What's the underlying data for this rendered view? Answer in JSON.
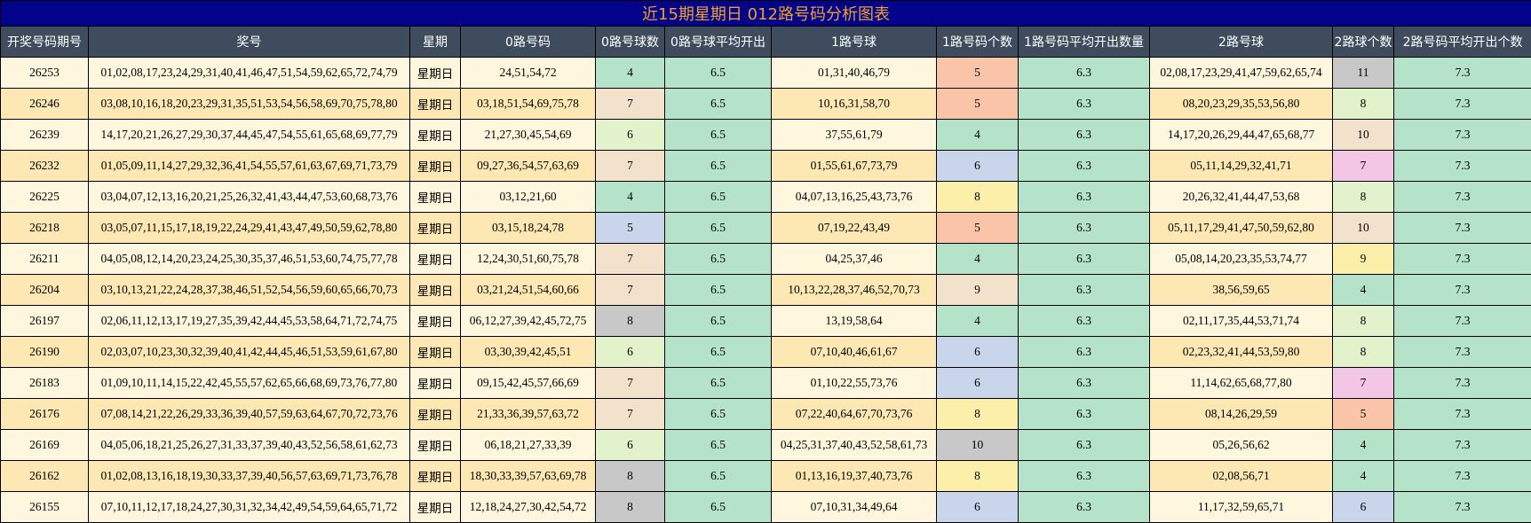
{
  "title": "近15期星期日 012路号码分析图表",
  "headers": [
    "开奖号码期号",
    "奖号",
    "星期",
    "0路号码",
    "0路号球数",
    "0路号球平均开出",
    "1路号球",
    "1路号码个数",
    "1路号码平均开出数量",
    "2路号球",
    "2路球个数",
    "2路号码平均开出个数"
  ],
  "colors": {
    "title_bg": "#02028a",
    "title_text": "#f0a030",
    "header_bg": "#3f4c5e",
    "row_light": "#fff7dd",
    "row_dark": "#fde8b3",
    "avg_green": "#b4e3c9"
  },
  "count_colors": {
    "4": "#b4e3c9",
    "5": "#f9c4a8",
    "6": "#e2f3cc",
    "7": "#f3e2cb",
    "8": "#c8c8c8",
    "9": "#f3e2cb",
    "10": "#c8c8c8",
    "11": "#c8c8c8"
  },
  "rows": [
    {
      "period": "26253",
      "numbers": "01,02,08,17,23,24,29,31,40,41,46,47,51,54,59,62,65,72,74,79",
      "weekday": "星期日",
      "r0": "24,51,54,72",
      "r0_count": "4",
      "r0_count_color": "#b4e3c9",
      "r0_avg": "6.5",
      "r1": "01,31,40,46,79",
      "r1_count": "5",
      "r1_count_color": "#f9c4a8",
      "r1_avg": "6.3",
      "r2": "02,08,17,23,29,41,47,59,62,65,74",
      "r2_count": "11",
      "r2_count_color": "#c8c8c8",
      "r2_avg": "7.3"
    },
    {
      "period": "26246",
      "numbers": "03,08,10,16,18,20,23,29,31,35,51,53,54,56,58,69,70,75,78,80",
      "weekday": "星期日",
      "r0": "03,18,51,54,69,75,78",
      "r0_count": "7",
      "r0_count_color": "#f3e2cb",
      "r0_avg": "6.5",
      "r1": "10,16,31,58,70",
      "r1_count": "5",
      "r1_count_color": "#f9c4a8",
      "r1_avg": "6.3",
      "r2": "08,20,23,29,35,53,56,80",
      "r2_count": "8",
      "r2_count_color": "#e2f3cc",
      "r2_avg": "7.3"
    },
    {
      "period": "26239",
      "numbers": "14,17,20,21,26,27,29,30,37,44,45,47,54,55,61,65,68,69,77,79",
      "weekday": "星期日",
      "r0": "21,27,30,45,54,69",
      "r0_count": "6",
      "r0_count_color": "#e2f3cc",
      "r0_avg": "6.5",
      "r1": "37,55,61,79",
      "r1_count": "4",
      "r1_count_color": "#b4e3c9",
      "r1_avg": "6.3",
      "r2": "14,17,20,26,29,44,47,65,68,77",
      "r2_count": "10",
      "r2_count_color": "#f3e2cb",
      "r2_avg": "7.3"
    },
    {
      "period": "26232",
      "numbers": "01,05,09,11,14,27,29,32,36,41,54,55,57,61,63,67,69,71,73,79",
      "weekday": "星期日",
      "r0": "09,27,36,54,57,63,69",
      "r0_count": "7",
      "r0_count_color": "#f3e2cb",
      "r0_avg": "6.5",
      "r1": "01,55,61,67,73,79",
      "r1_count": "6",
      "r1_count_color": "#c9d5ea",
      "r1_avg": "6.3",
      "r2": "05,11,14,29,32,41,71",
      "r2_count": "7",
      "r2_count_color": "#f2c6e4",
      "r2_avg": "7.3"
    },
    {
      "period": "26225",
      "numbers": "03,04,07,12,13,16,20,21,25,26,32,41,43,44,47,53,60,68,73,76",
      "weekday": "星期日",
      "r0": "03,12,21,60",
      "r0_count": "4",
      "r0_count_color": "#b4e3c9",
      "r0_avg": "6.5",
      "r1": "04,07,13,16,25,43,73,76",
      "r1_count": "8",
      "r1_count_color": "#fcefaa",
      "r1_avg": "6.3",
      "r2": "20,26,32,41,44,47,53,68",
      "r2_count": "8",
      "r2_count_color": "#e2f3cc",
      "r2_avg": "7.3"
    },
    {
      "period": "26218",
      "numbers": "03,05,07,11,15,17,18,19,22,24,29,41,43,47,49,50,59,62,78,80",
      "weekday": "星期日",
      "r0": "03,15,18,24,78",
      "r0_count": "5",
      "r0_count_color": "#c9d5ea",
      "r0_avg": "6.5",
      "r1": "07,19,22,43,49",
      "r1_count": "5",
      "r1_count_color": "#f9c4a8",
      "r1_avg": "6.3",
      "r2": "05,11,17,29,41,47,50,59,62,80",
      "r2_count": "10",
      "r2_count_color": "#f3e2cb",
      "r2_avg": "7.3"
    },
    {
      "period": "26211",
      "numbers": "04,05,08,12,14,20,23,24,25,30,35,37,46,51,53,60,74,75,77,78",
      "weekday": "星期日",
      "r0": "12,24,30,51,60,75,78",
      "r0_count": "7",
      "r0_count_color": "#f3e2cb",
      "r0_avg": "6.5",
      "r1": "04,25,37,46",
      "r1_count": "4",
      "r1_count_color": "#b4e3c9",
      "r1_avg": "6.3",
      "r2": "05,08,14,20,23,35,53,74,77",
      "r2_count": "9",
      "r2_count_color": "#fcefaa",
      "r2_avg": "7.3"
    },
    {
      "period": "26204",
      "numbers": "03,10,13,21,22,24,28,37,38,46,51,52,54,56,59,60,65,66,70,73",
      "weekday": "星期日",
      "r0": "03,21,24,51,54,60,66",
      "r0_count": "7",
      "r0_count_color": "#f3e2cb",
      "r0_avg": "6.5",
      "r1": "10,13,22,28,37,46,52,70,73",
      "r1_count": "9",
      "r1_count_color": "#f3e2cb",
      "r1_avg": "6.3",
      "r2": "38,56,59,65",
      "r2_count": "4",
      "r2_count_color": "#b4e3c9",
      "r2_avg": "7.3"
    },
    {
      "period": "26197",
      "numbers": "02,06,11,12,13,17,19,27,35,39,42,44,45,53,58,64,71,72,74,75",
      "weekday": "星期日",
      "r0": "06,12,27,39,42,45,72,75",
      "r0_count": "8",
      "r0_count_color": "#c8c8c8",
      "r0_avg": "6.5",
      "r1": "13,19,58,64",
      "r1_count": "4",
      "r1_count_color": "#b4e3c9",
      "r1_avg": "6.3",
      "r2": "02,11,17,35,44,53,71,74",
      "r2_count": "8",
      "r2_count_color": "#e2f3cc",
      "r2_avg": "7.3"
    },
    {
      "period": "26190",
      "numbers": "02,03,07,10,23,30,32,39,40,41,42,44,45,46,51,53,59,61,67,80",
      "weekday": "星期日",
      "r0": "03,30,39,42,45,51",
      "r0_count": "6",
      "r0_count_color": "#e2f3cc",
      "r0_avg": "6.5",
      "r1": "07,10,40,46,61,67",
      "r1_count": "6",
      "r1_count_color": "#c9d5ea",
      "r1_avg": "6.3",
      "r2": "02,23,32,41,44,53,59,80",
      "r2_count": "8",
      "r2_count_color": "#e2f3cc",
      "r2_avg": "7.3"
    },
    {
      "period": "26183",
      "numbers": "01,09,10,11,14,15,22,42,45,55,57,62,65,66,68,69,73,76,77,80",
      "weekday": "星期日",
      "r0": "09,15,42,45,57,66,69",
      "r0_count": "7",
      "r0_count_color": "#f3e2cb",
      "r0_avg": "6.5",
      "r1": "01,10,22,55,73,76",
      "r1_count": "6",
      "r1_count_color": "#c9d5ea",
      "r1_avg": "6.3",
      "r2": "11,14,62,65,68,77,80",
      "r2_count": "7",
      "r2_count_color": "#f2c6e4",
      "r2_avg": "7.3"
    },
    {
      "period": "26176",
      "numbers": "07,08,14,21,22,26,29,33,36,39,40,57,59,63,64,67,70,72,73,76",
      "weekday": "星期日",
      "r0": "21,33,36,39,57,63,72",
      "r0_count": "7",
      "r0_count_color": "#f3e2cb",
      "r0_avg": "6.5",
      "r1": "07,22,40,64,67,70,73,76",
      "r1_count": "8",
      "r1_count_color": "#fcefaa",
      "r1_avg": "6.3",
      "r2": "08,14,26,29,59",
      "r2_count": "5",
      "r2_count_color": "#f9c4a8",
      "r2_avg": "7.3"
    },
    {
      "period": "26169",
      "numbers": "04,05,06,18,21,25,26,27,31,33,37,39,40,43,52,56,58,61,62,73",
      "weekday": "星期日",
      "r0": "06,18,21,27,33,39",
      "r0_count": "6",
      "r0_count_color": "#e2f3cc",
      "r0_avg": "6.5",
      "r1": "04,25,31,37,40,43,52,58,61,73",
      "r1_count": "10",
      "r1_count_color": "#c8c8c8",
      "r1_avg": "6.3",
      "r2": "05,26,56,62",
      "r2_count": "4",
      "r2_count_color": "#b4e3c9",
      "r2_avg": "7.3"
    },
    {
      "period": "26162",
      "numbers": "01,02,08,13,16,18,19,30,33,37,39,40,56,57,63,69,71,73,76,78",
      "weekday": "星期日",
      "r0": "18,30,33,39,57,63,69,78",
      "r0_count": "8",
      "r0_count_color": "#c8c8c8",
      "r0_avg": "6.5",
      "r1": "01,13,16,19,37,40,73,76",
      "r1_count": "8",
      "r1_count_color": "#fcefaa",
      "r1_avg": "6.3",
      "r2": "02,08,56,71",
      "r2_count": "4",
      "r2_count_color": "#b4e3c9",
      "r2_avg": "7.3"
    },
    {
      "period": "26155",
      "numbers": "07,10,11,12,17,18,24,27,30,31,32,34,42,49,54,59,64,65,71,72",
      "weekday": "星期日",
      "r0": "12,18,24,27,30,42,54,72",
      "r0_count": "8",
      "r0_count_color": "#c8c8c8",
      "r0_avg": "6.5",
      "r1": "07,10,31,34,49,64",
      "r1_count": "6",
      "r1_count_color": "#c9d5ea",
      "r1_avg": "6.3",
      "r2": "11,17,32,59,65,71",
      "r2_count": "6",
      "r2_count_color": "#c9d5ea",
      "r2_avg": "7.3"
    }
  ]
}
